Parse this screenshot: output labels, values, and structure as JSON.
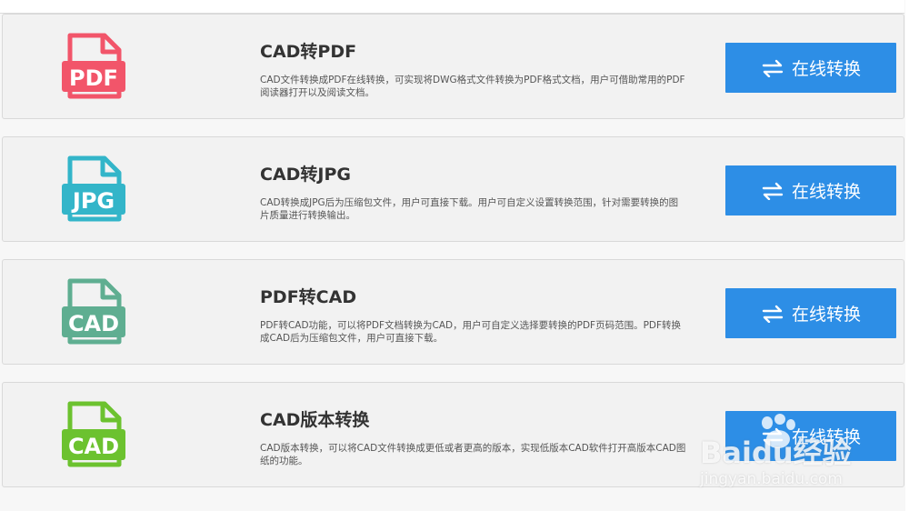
{
  "cards": [
    {
      "title": "CAD转PDF",
      "description": "CAD文件转换成PDF在线转换，可实现将DWG格式文件转换为PDF格式文档，用户可借助常用的PDF阅读器打开以及阅读文档。",
      "icon_label": "PDF",
      "icon_name": "pdf-file-icon",
      "icon_color": "#f2556a",
      "button_label": "在线转换"
    },
    {
      "title": "CAD转JPG",
      "description": "CAD转换成JPG后为压缩包文件，用户可直接下载。用户可自定义设置转换范围，针对需要转换的图片质量进行转换输出。",
      "icon_label": "JPG",
      "icon_name": "jpg-file-icon",
      "icon_color": "#33b5c9",
      "button_label": "在线转换"
    },
    {
      "title": "PDF转CAD",
      "description": "PDF转CAD功能，可以将PDF文档转换为CAD，用户可自定义选择要转换的PDF页码范围。PDF转换成CAD后为压缩包文件，用户可直接下载。",
      "icon_label": "CAD",
      "icon_name": "cad-file-icon",
      "icon_color": "#5fae91",
      "button_label": "在线转换"
    },
    {
      "title": "CAD版本转换",
      "description": "CAD版本转换，可以将CAD文件转换成更低或者更高的版本，实现低版本CAD软件打开高版本CAD图纸的功能。",
      "icon_label": "CAD",
      "icon_name": "cad-version-file-icon",
      "icon_color": "#6cc22f",
      "button_label": "在线转换"
    }
  ],
  "button_color": "#2d8ee6",
  "button_icon": "swap-arrows-icon",
  "watermark": {
    "logo": "Baidu经验",
    "url": "jingyan.baidu.com"
  }
}
